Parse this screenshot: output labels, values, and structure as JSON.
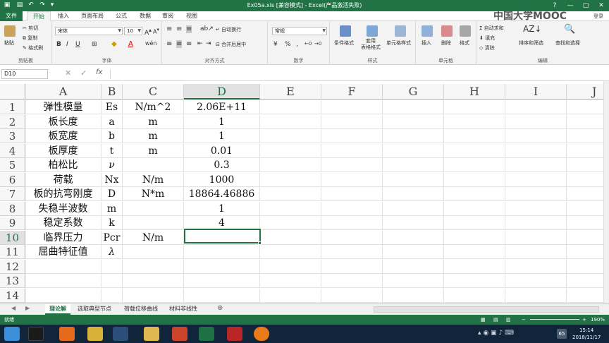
{
  "window": {
    "title": "Ex05a.xls  [兼容模式] - Excel(产品激活失败)",
    "controls": [
      "?",
      "—",
      "▢",
      "✕"
    ]
  },
  "menu": {
    "file": "文件",
    "items": [
      "开始",
      "插入",
      "页面布局",
      "公式",
      "数据",
      "审阅",
      "视图"
    ],
    "login": "登录",
    "watermark": "中国大学MOOC"
  },
  "ribbon": {
    "clipboard": {
      "paste": "粘贴",
      "cut": "剪切",
      "copy": "复制",
      "format_painter": "格式刷",
      "label": "剪贴板"
    },
    "font": {
      "name": "宋体",
      "size": "10",
      "label": "字体"
    },
    "alignment": {
      "wrap": "自动换行",
      "merge": "合并后居中",
      "label": "对齐方式"
    },
    "number": {
      "format": "常规",
      "label": "数字"
    },
    "styles": {
      "cond": "条件格式",
      "table": "套用\n表格格式",
      "cell": "单元格样式",
      "label": "样式"
    },
    "cells": {
      "insert": "插入",
      "delete": "删除",
      "format": "格式",
      "label": "单元格"
    },
    "editing": {
      "autosum": "自动求和",
      "fill": "填充",
      "clear": "清除",
      "sort": "排序和筛选",
      "find": "查找和选择",
      "label": "编辑"
    }
  },
  "formula_bar": {
    "name_box": "D10",
    "fx": "fx",
    "value": ""
  },
  "grid": {
    "columns": [
      "A",
      "B",
      "C",
      "D",
      "E",
      "F",
      "G",
      "H",
      "I",
      "J"
    ],
    "selected_column": "D",
    "rows": [
      "1",
      "2",
      "3",
      "4",
      "5",
      "6",
      "7",
      "8",
      "9",
      "10",
      "11",
      "12",
      "13",
      "14"
    ],
    "selected_row": "10",
    "cells": [
      [
        "弹性模量",
        "Es",
        "N/m^2",
        "2.06E+11"
      ],
      [
        "板长度",
        "a",
        "m",
        "1"
      ],
      [
        "板宽度",
        "b",
        "m",
        "1"
      ],
      [
        "板厚度",
        "t",
        "m",
        "0.01"
      ],
      [
        "柏松比",
        "ν",
        "",
        "0.3"
      ],
      [
        "荷载",
        "Nx",
        "N/m",
        "1000"
      ],
      [
        "板的抗弯刚度",
        "D",
        "N*m",
        "18864.46886"
      ],
      [
        "失稳半波数",
        "m",
        "",
        "1"
      ],
      [
        "稳定系数",
        "k",
        "",
        "4"
      ],
      [
        "临界压力",
        "Pcr",
        "N/m",
        ""
      ],
      [
        "屈曲特征值",
        "λ",
        "",
        ""
      ]
    ]
  },
  "sheet_tabs": [
    "理论解",
    "选取典型节点",
    "荷载位移曲线",
    "材料非线性"
  ],
  "active_tab": "理论解",
  "status": {
    "ready": "就绪",
    "zoom": "190%"
  },
  "taskbar": {
    "time": "15:14",
    "date": "2018/11/17",
    "badge": "65"
  },
  "colors": {
    "accent": "#217346",
    "taskbar": "#10243a"
  }
}
